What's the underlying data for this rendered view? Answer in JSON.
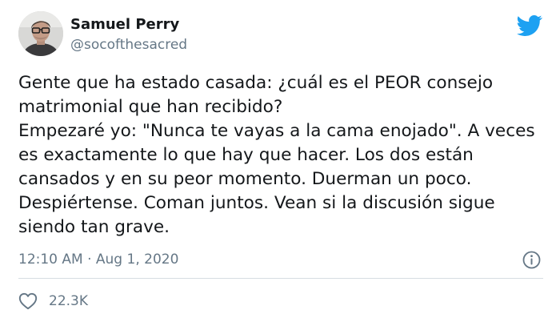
{
  "author": {
    "name": "Samuel Perry",
    "handle": "@socofthesacred"
  },
  "tweet": {
    "lines": [
      "Gente que ha estado casada: ¿cuál es el PEOR consejo",
      "matrimonial que han recibido?",
      "Empezaré yo: \"Nunca te vayas a la cama enojado\". A veces",
      "es exactamente lo que hay que hacer. Los dos están",
      "cansados y en su peor momento. Duerman un poco.",
      "Despiértense. Coman juntos. Vean si la discusión sigue",
      "siendo tan grave."
    ],
    "timestamp": "12:10 AM · Aug 1, 2020",
    "likes": "22.3K"
  },
  "icons": {
    "brand": "twitter-bird-icon",
    "info": "info-icon",
    "like": "heart-icon"
  },
  "colors": {
    "brand": "#1da1f2",
    "text": "#14171a",
    "secondary": "#657786",
    "divider": "#d6dde2"
  }
}
